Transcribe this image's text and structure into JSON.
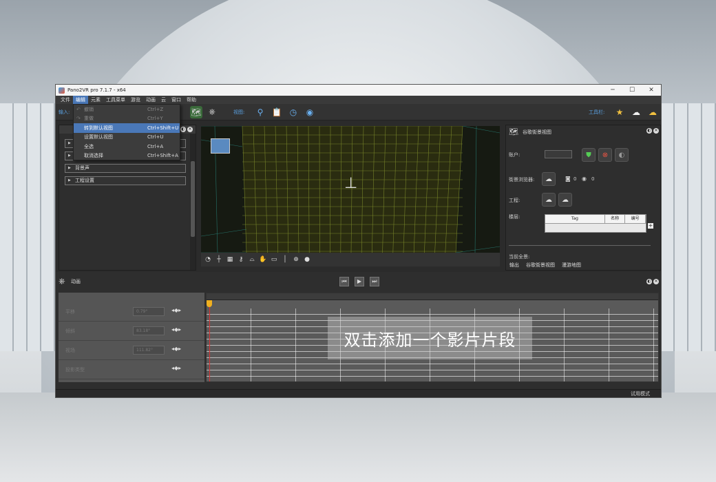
{
  "window": {
    "title": "Pano2VR pro 7.1.7 - x64",
    "minimize": "─",
    "maximize": "☐",
    "close": "✕"
  },
  "menubar": [
    "文件",
    "编辑",
    "元素",
    "工具菜单",
    "游览",
    "动画",
    "云",
    "窗口",
    "帮助"
  ],
  "toolbar": {
    "input_label": "输入:",
    "view_label": "视图:",
    "tools_label": "工具栏:"
  },
  "edit_menu": [
    {
      "label": "撤销",
      "shortcut": "Ctrl+Z",
      "disabled": true
    },
    {
      "label": "重做",
      "shortcut": "Ctrl+Y",
      "disabled": true
    },
    {
      "label": "转到默认视图",
      "shortcut": "Ctrl+Shift+U",
      "highlighted": true
    },
    {
      "label": "设置默认视图",
      "shortcut": "Ctrl+U"
    },
    {
      "label": "全选",
      "shortcut": "Ctrl+A"
    },
    {
      "label": "取消选择",
      "shortcut": "Ctrl+Shift+A"
    }
  ],
  "left_panel": {
    "sections": [
      "背景声",
      "工程设置"
    ]
  },
  "right_panel": {
    "title": "谷歌街景视图",
    "account_label": "账户:",
    "browser_label": "街景浏览器:",
    "browser_counts": [
      "0",
      "0"
    ],
    "project_label": "工程:",
    "tier_label": "楼层:",
    "table_headers": [
      "Tag",
      "名称",
      "编号"
    ],
    "current_label": "当前全景:",
    "tabs": [
      "输出",
      "谷歌街景视图",
      "漫游地图"
    ]
  },
  "animation": {
    "title": "动画",
    "tracks": [
      {
        "name": "平移",
        "value": "0.79°"
      },
      {
        "name": "倾斜",
        "value": "83.18°"
      },
      {
        "name": "视场",
        "value": "111.82°"
      },
      {
        "name": "投影类型",
        "value": ""
      }
    ],
    "hint": "双击添加一个影片片段"
  },
  "status": {
    "mode": "试用模式"
  },
  "colors": {
    "accent": "#4a78b8",
    "label_blue": "#5aa0e0",
    "playhead": "#d83030"
  }
}
